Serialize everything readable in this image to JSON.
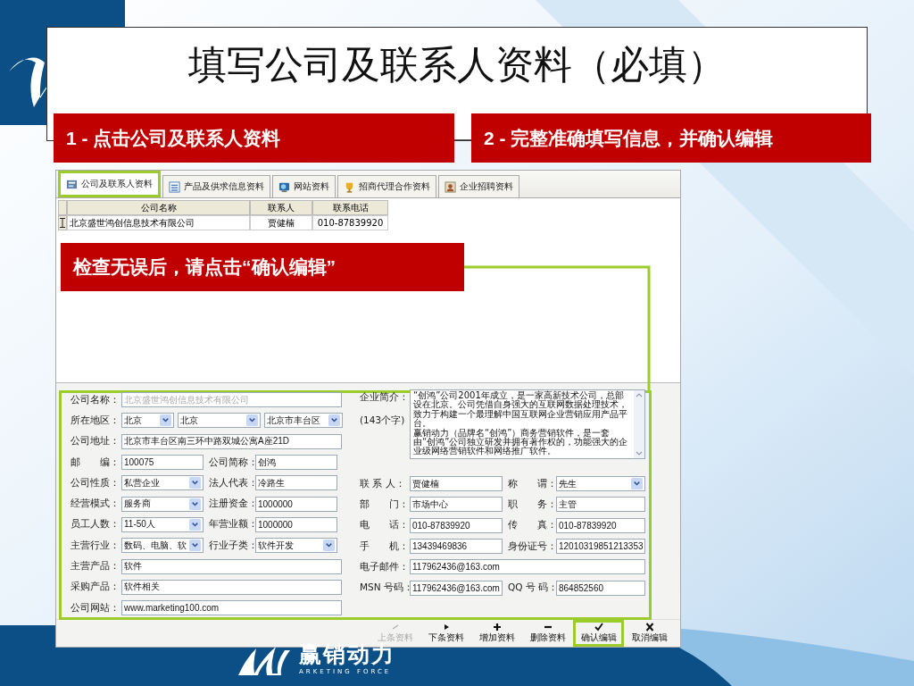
{
  "slide": {
    "title": "填写公司及联系人资料（必填）",
    "callouts": [
      "1 - 点击公司及联系人资料",
      "2 - 完整准确填写信息，并确认编辑",
      "检查无误后，请点击“确认编辑”"
    ],
    "logo": {
      "name": "赢销动力",
      "tagline": "ARKETING FORCE"
    }
  },
  "tabs": [
    {
      "label": "公司及联系人资料",
      "selected": true,
      "highlighted": true
    },
    {
      "label": "产品及供求信息资料",
      "selected": false,
      "highlighted": false
    },
    {
      "label": "网站资料",
      "selected": false,
      "highlighted": false
    },
    {
      "label": "招商代理合作资料",
      "selected": false,
      "highlighted": false
    },
    {
      "label": "企业招聘资料",
      "selected": false,
      "highlighted": false
    }
  ],
  "table": {
    "columns": [
      "公司名称",
      "联系人",
      "联系电话"
    ],
    "rows": [
      [
        "北京盛世鸿创信息技术有限公司",
        "贾健楠",
        "010-87839920"
      ]
    ]
  },
  "left_rows": [
    {
      "kind": "full",
      "fields": [
        {
          "label": "公司名称：",
          "value": "北京盛世鸿创信息技术有限公司",
          "kind": "text",
          "disabled": true
        }
      ]
    },
    {
      "kind": "region",
      "fields": [
        {
          "label": "所在地区：",
          "value": "北京",
          "kind": "select",
          "disabled": false
        },
        {
          "value": "北京",
          "kind": "select",
          "disabled": false
        },
        {
          "value": "北京市丰台区",
          "kind": "select",
          "disabled": false
        }
      ]
    },
    {
      "kind": "full",
      "fields": [
        {
          "label": "公司地址：",
          "value": "北京市丰台区南三环中路双城公寓A座21D",
          "kind": "text",
          "disabled": false
        }
      ]
    },
    {
      "kind": "pair",
      "fields": [
        {
          "label": "邮　　编：",
          "value": "100075",
          "kind": "text",
          "disabled": false
        },
        {
          "label": "公司简称：",
          "value": "创鸿",
          "kind": "text",
          "disabled": false
        }
      ]
    },
    {
      "kind": "pair",
      "fields": [
        {
          "label": "公司性质：",
          "value": "私营企业",
          "kind": "select",
          "disabled": false
        },
        {
          "label": "法人代表：",
          "value": "冷路生",
          "kind": "text",
          "disabled": false
        }
      ]
    },
    {
      "kind": "pair",
      "fields": [
        {
          "label": "经营模式：",
          "value": "服务商",
          "kind": "select",
          "disabled": false
        },
        {
          "label": "注册资金：",
          "value": "1000000",
          "kind": "text",
          "disabled": false
        }
      ]
    },
    {
      "kind": "pair",
      "fields": [
        {
          "label": "员工人数：",
          "value": "11-50人",
          "kind": "select",
          "disabled": false
        },
        {
          "label": "年营业额：",
          "value": "1000000",
          "kind": "text",
          "disabled": false
        }
      ]
    },
    {
      "kind": "pair",
      "fields": [
        {
          "label": "主营行业：",
          "value": "数码、电脑、软",
          "kind": "select",
          "disabled": false
        },
        {
          "label": "行业子类：",
          "value": "软件开发",
          "kind": "select",
          "disabled": false
        }
      ]
    },
    {
      "kind": "full",
      "fields": [
        {
          "label": "主营产品：",
          "value": "软件",
          "kind": "text",
          "disabled": false
        }
      ]
    },
    {
      "kind": "full",
      "fields": [
        {
          "label": "采购产品：",
          "value": "软件相关",
          "kind": "text",
          "disabled": false
        }
      ]
    },
    {
      "kind": "full",
      "fields": [
        {
          "label": "公司网站：",
          "value": "www.marketing100.com",
          "kind": "text",
          "disabled": false
        }
      ]
    }
  ],
  "profile": {
    "label": "企业简介：",
    "note": "(143个字)",
    "paragraphs": [
      "“创鸿”公司2001年成立，是一家高新技术公司，总部设在北京。公司凭借自身强大的互联网数据处理技术，致力于构建一个最理解中国互联网企业营销应用产品平台。",
      "赢销动力（品牌名“创鸿”）商务营销软件，是一套由“创鸿”公司独立研发并拥有著作权的，功能强大的企业级网络营销软件和网络推广软件。"
    ]
  },
  "right_rows": [
    {
      "kind": "pair",
      "fields": [
        {
          "label": "联 系 人：",
          "value": "贾健楠",
          "kind": "text",
          "disabled": false
        },
        {
          "label": "称　　谓：",
          "value": "先生",
          "kind": "select",
          "disabled": false
        }
      ]
    },
    {
      "kind": "pair",
      "fields": [
        {
          "label": "部　　门：",
          "value": "市场中心",
          "kind": "text",
          "disabled": false
        },
        {
          "label": "职　　务：",
          "value": "主管",
          "kind": "text",
          "disabled": false
        }
      ]
    },
    {
      "kind": "pair",
      "fields": [
        {
          "label": "电　　话：",
          "value": "010-87839920",
          "kind": "text",
          "disabled": false
        },
        {
          "label": "传　　真：",
          "value": "010-87839920",
          "kind": "text",
          "disabled": false
        }
      ]
    },
    {
      "kind": "pair",
      "fields": [
        {
          "label": "手　　机：",
          "value": "13439469836",
          "kind": "text",
          "disabled": false
        },
        {
          "label": "身份证号：",
          "value": "12010319851213353",
          "kind": "text",
          "disabled": false
        }
      ]
    },
    {
      "kind": "full",
      "fields": [
        {
          "label": "电子邮件：",
          "value": "117962436@163.com",
          "kind": "text",
          "disabled": false
        }
      ]
    },
    {
      "kind": "pair",
      "fields": [
        {
          "label": "MSN 号码：",
          "value": "117962436@163.com",
          "kind": "text",
          "disabled": false
        },
        {
          "label": "QQ 号 码：",
          "value": "864852560",
          "kind": "text",
          "disabled": false
        }
      ]
    }
  ],
  "toolbar": [
    {
      "label": "上条资料",
      "disabled": true,
      "highlighted": false
    },
    {
      "label": "下条资料",
      "disabled": false,
      "highlighted": false
    },
    {
      "label": "增加资料",
      "disabled": false,
      "highlighted": false
    },
    {
      "label": "删除资料",
      "disabled": false,
      "highlighted": false
    },
    {
      "label": "确认编辑",
      "disabled": false,
      "highlighted": true
    },
    {
      "label": "取消编辑",
      "disabled": false,
      "highlighted": false
    }
  ]
}
